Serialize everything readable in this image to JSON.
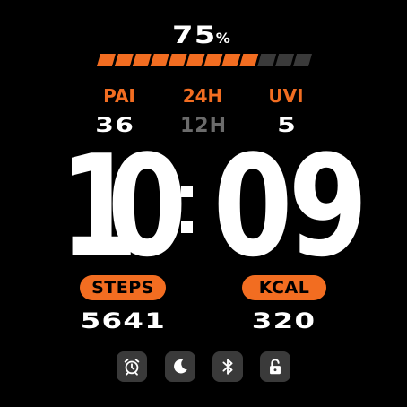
{
  "battery": {
    "value": "75",
    "unit": "%",
    "level": 0.75,
    "segments_total": 12,
    "segments_filled": 9,
    "fill_color": "#f26d21",
    "empty_color": "#3a3a3a"
  },
  "stats": {
    "pai": {
      "label": "PAI",
      "value": "36"
    },
    "format": {
      "label": "24H",
      "value": "12H"
    },
    "uvi": {
      "label": "UVI",
      "value": "5"
    }
  },
  "time": {
    "h1": "1",
    "h2": "0",
    "m1": "0",
    "m2": "9"
  },
  "steps": {
    "label": "STEPS",
    "value": "5641"
  },
  "kcal": {
    "label": "KCAL",
    "value": "320"
  },
  "icons": [
    "alarm-icon",
    "moon-icon",
    "bluetooth-icon",
    "unlock-icon"
  ],
  "colors": {
    "accent": "#f26d21",
    "primary_text": "#ffffff",
    "muted_text": "#6b6b6b",
    "background": "#000000",
    "icon_bg": "#3a3a3a"
  }
}
